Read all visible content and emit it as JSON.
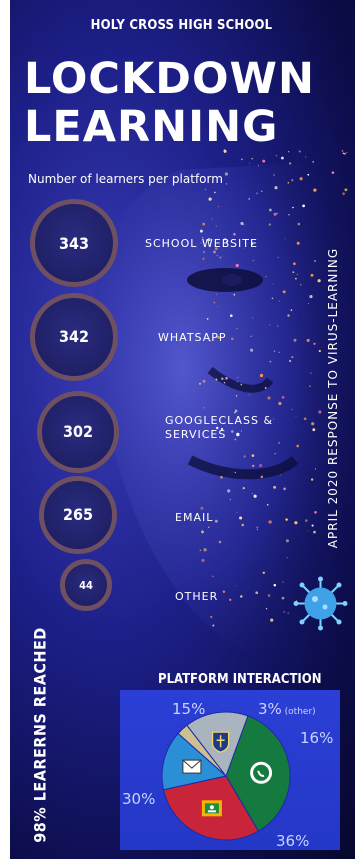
{
  "school": "HOLY CROSS HIGH SCHOOL",
  "title_line1": "LOCKDOWN",
  "title_line2": "LEARNING",
  "subtitle": "Number of learners  per platform",
  "vertical_caption": "APRIL 2020  RESPONSE TO VIRUS-LEARNING",
  "reached_caption": "98% LEARERNS REACHED",
  "pie_title": "PLATFORM INTERACTION",
  "colors": {
    "accent_ring": "#6e5062",
    "pie_red": "#c8243a",
    "pie_green": "#157a3f",
    "pie_blue": "#2a8fd6",
    "pie_gray": "#a9b4be",
    "pie_tan": "#cdbf8f",
    "panel_blue": "#2b3fd6"
  },
  "chart_data": [
    {
      "type": "bar",
      "title": "",
      "categories": [
        "SCHOOL WEBSITE",
        "WHATSAPP",
        "GOOGLECLASS & SERVICES",
        "EMAIL",
        "OTHER"
      ],
      "values": [
        343,
        342,
        302,
        265,
        44
      ],
      "labels": [
        "343",
        "342",
        "302",
        "265",
        "44"
      ]
    },
    {
      "type": "pie",
      "title": "PLATFORM INTERACTION",
      "slices": [
        {
          "value": 36,
          "label": "36%",
          "color": "#157a3f",
          "icon": "whatsapp-icon"
        },
        {
          "value": 30,
          "label": "30%",
          "color": "#c8243a",
          "icon": "google-classroom-icon"
        },
        {
          "value": 15,
          "label": "15%",
          "color": "#2a8fd6",
          "icon": "email-icon"
        },
        {
          "value": 3,
          "label": "3%",
          "note": "(other)",
          "color": "#cdbf8f",
          "icon": ""
        },
        {
          "value": 16,
          "label": "16%",
          "color": "#a9b4be",
          "icon": "school-crest-icon"
        }
      ]
    }
  ]
}
